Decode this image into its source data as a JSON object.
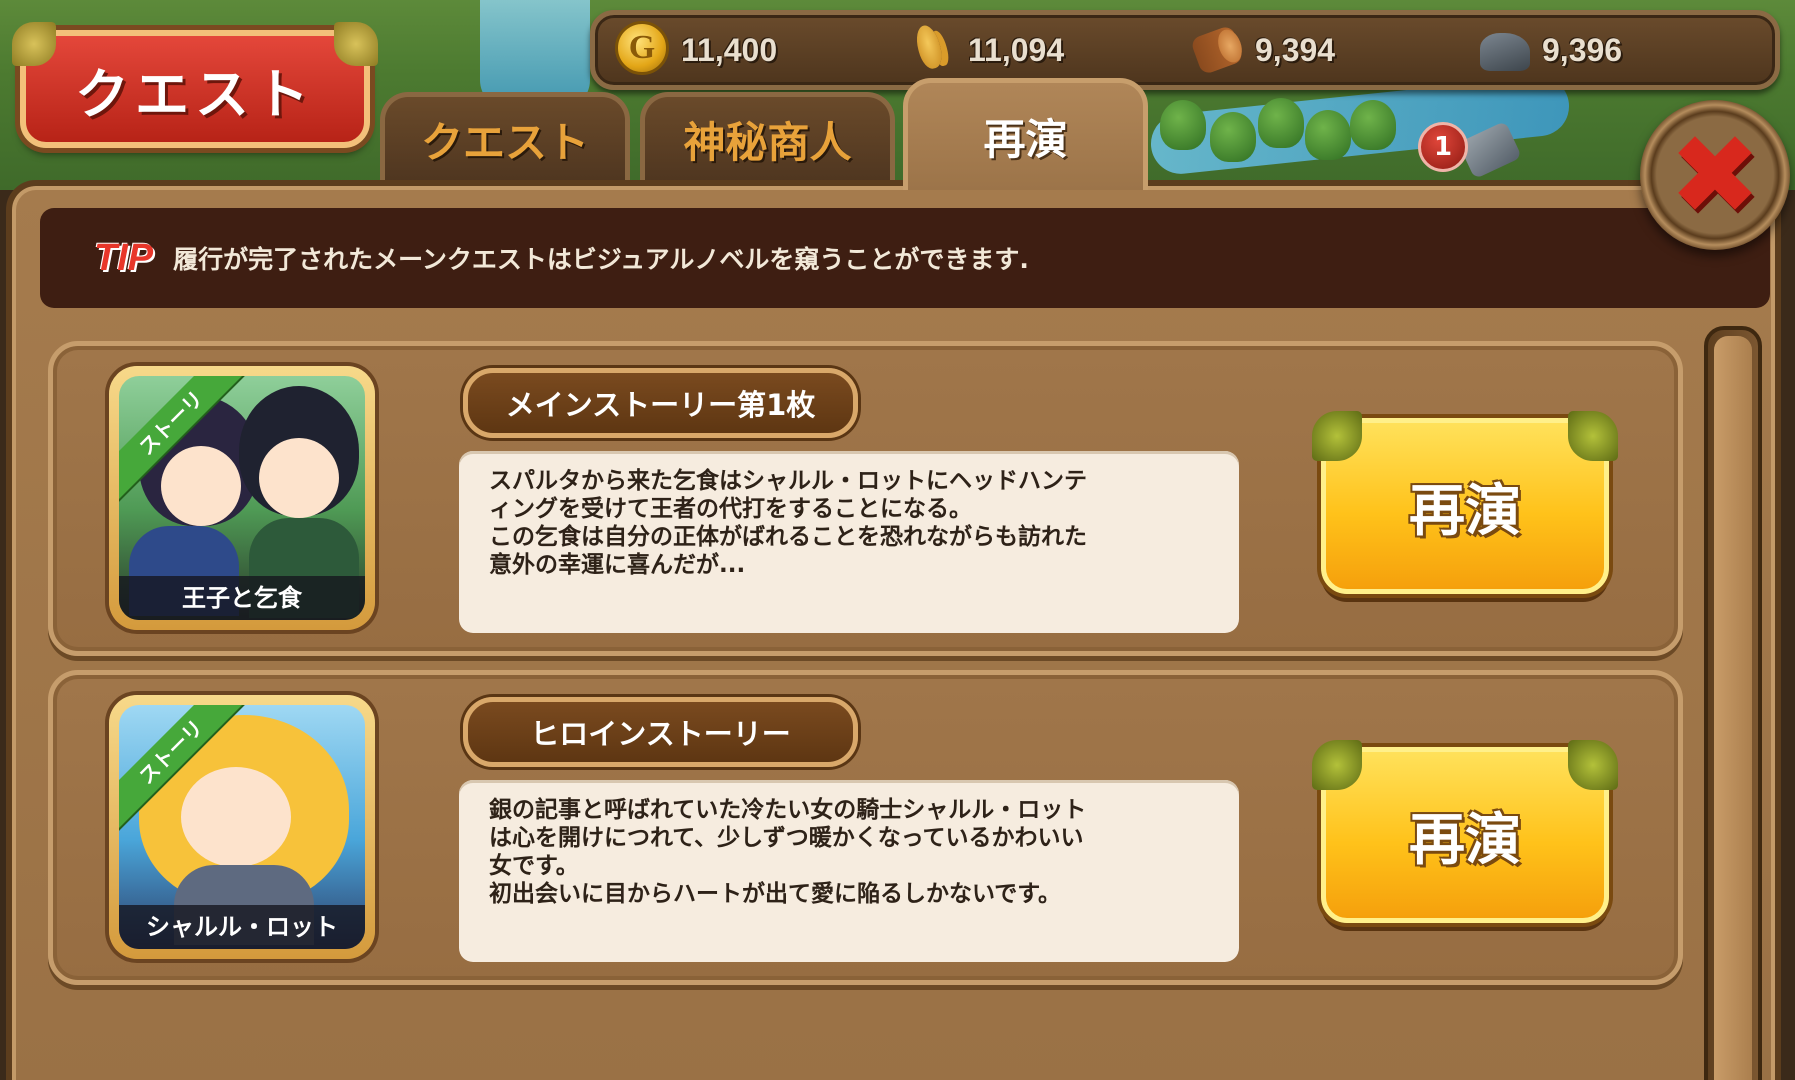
{
  "resources": [
    {
      "icon": "gold-coin-icon",
      "glyph": "G",
      "value": "11,400"
    },
    {
      "icon": "wheat-icon",
      "value": "11,094"
    },
    {
      "icon": "wood-log-icon",
      "value": "9,394"
    },
    {
      "icon": "stone-icon",
      "value": "9,396"
    }
  ],
  "title": "クエスト",
  "tabs": [
    {
      "label": "クエスト",
      "active": false
    },
    {
      "label": "神秘商人",
      "active": false
    },
    {
      "label": "再演",
      "active": true
    }
  ],
  "notification_count": "1",
  "tip": {
    "tag": "TIP",
    "text": "履行が完了されたメーンクエストはビジュアルノベルを窺うことができます."
  },
  "stories": [
    {
      "ribbon": "ストーリ",
      "thumb_label": "王子と乞食",
      "title": "メインストーリー第1枚",
      "desc_lines": [
        "スパルタから来た乞食はシャルル・ロットにヘッドハンテ",
        "ィングを受けて王者の代打をすることになる。",
        "この乞食は自分の正体がばれることを恐れながらも訪れた",
        "意外の幸運に喜んだが..."
      ],
      "button": "再演"
    },
    {
      "ribbon": "ストーリ",
      "thumb_label": "シャルル・ロット",
      "title": "ヒロインストーリー",
      "desc_lines": [
        "銀の記事と呼ばれていた冷たい女の騎士シャルル・ロット",
        "は心を開けにつれて、少しずつ暖かくなっているかわいい",
        "女です。",
        "初出会いに目からハートが出て愛に陥るしかないです。"
      ],
      "button": "再演"
    }
  ],
  "colors": {
    "accent_red": "#d8281d",
    "button_yellow": "#ffc21a",
    "panel_brown": "#a57b4d",
    "tab_text": "#e8a23a"
  }
}
